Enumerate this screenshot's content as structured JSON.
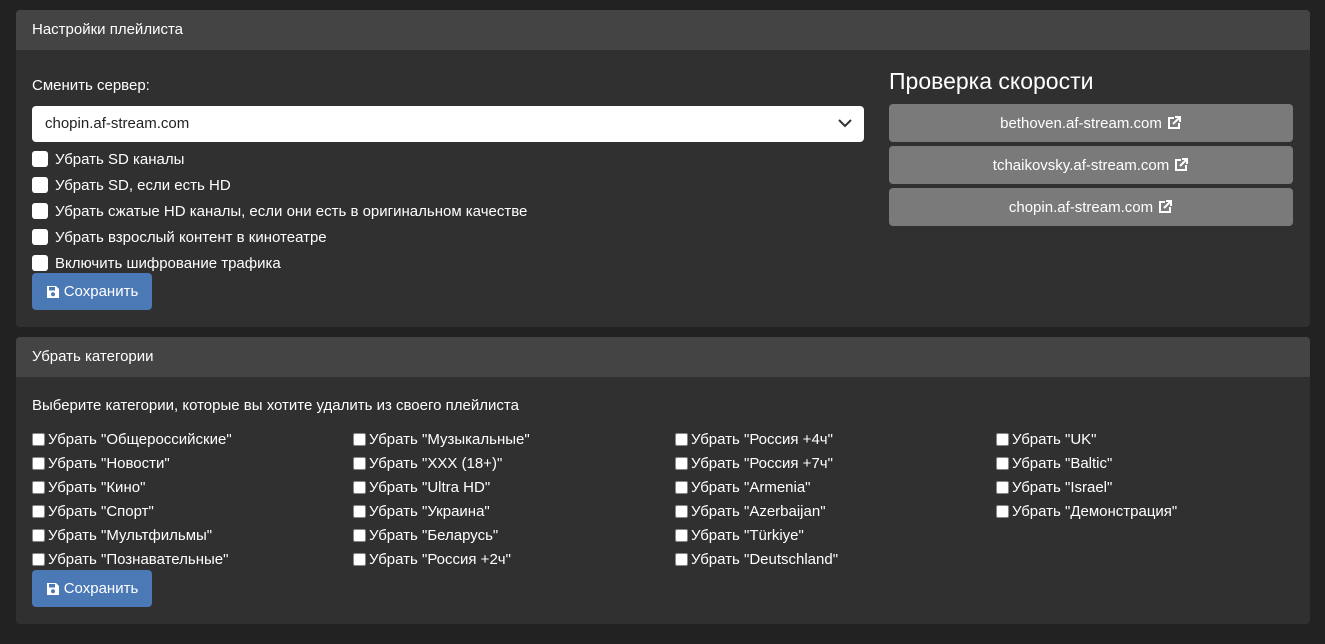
{
  "playlist_settings": {
    "header": "Настройки плейлиста",
    "server_label": "Сменить сервер:",
    "server_selected": "chopin.af-stream.com",
    "options": [
      "Убрать SD каналы",
      "Убрать SD, если есть HD",
      "Убрать сжатые HD каналы, если они есть в оригинальном качестве",
      "Убрать взрослый контент в кинотеатре",
      "Включить шифрование трафика"
    ],
    "save_label": "Сохранить"
  },
  "speed_test": {
    "title": "Проверка скорости",
    "servers": [
      "bethoven.af-stream.com",
      "tchaikovsky.af-stream.com",
      "chopin.af-stream.com"
    ]
  },
  "categories": {
    "header": "Убрать категории",
    "description": "Выберите категории, которые вы хотите удалить из своего плейлиста",
    "columns": [
      [
        "Убрать \"Общероссийские\"",
        "Убрать \"Новости\"",
        "Убрать \"Кино\"",
        "Убрать \"Спорт\"",
        "Убрать \"Мультфильмы\"",
        "Убрать \"Познавательные\""
      ],
      [
        "Убрать \"Музыкальные\"",
        "Убрать \"XXX (18+)\"",
        "Убрать \"Ultra HD\"",
        "Убрать \"Украина\"",
        "Убрать \"Беларусь\"",
        "Убрать \"Россия +2ч\""
      ],
      [
        "Убрать \"Россия +4ч\"",
        "Убрать \"Россия +7ч\"",
        "Убрать \"Armenia\"",
        "Убрать \"Azerbaijan\"",
        "Убрать \"Türkiye\"",
        "Убрать \"Deutschland\""
      ],
      [
        "Убрать \"UK\"",
        "Убрать \"Baltic\"",
        "Убрать \"Israel\"",
        "Убрать \"Демонстрация\""
      ]
    ],
    "save_label": "Сохранить"
  },
  "icons": {
    "save": "floppy-disk-icon",
    "external": "external-link-icon",
    "select": "chevron-down-icon"
  }
}
